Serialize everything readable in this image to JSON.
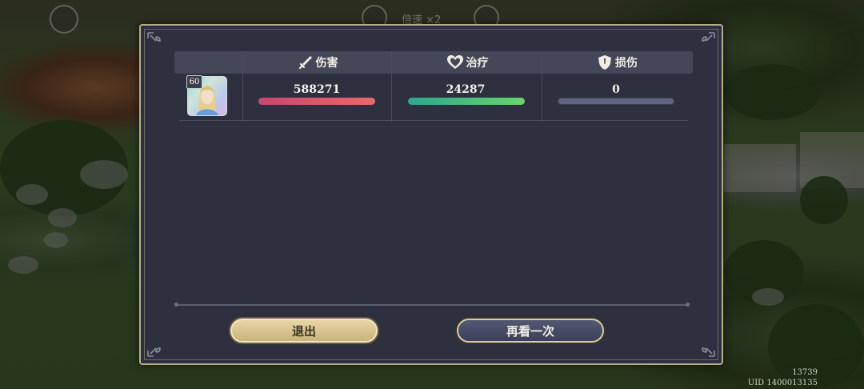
{
  "hud": {
    "speed_label": "倍速 ×2",
    "player_id": "13739",
    "uid": "UID 1400013135"
  },
  "panel": {
    "columns": [
      {
        "label": "伤害",
        "icon": "sword-icon"
      },
      {
        "label": "治疗",
        "icon": "heart-icon"
      },
      {
        "label": "损伤",
        "icon": "shield-icon"
      }
    ],
    "rows": [
      {
        "level": "60",
        "damage": {
          "value": "588271",
          "fill": 1.0,
          "color_from": "#c5486f",
          "color_to": "#e86a6a"
        },
        "healing": {
          "value": "24287",
          "fill": 1.0,
          "color_from": "#2fa58e",
          "color_to": "#6cd26a"
        },
        "taken": {
          "value": "0",
          "fill": 0.0,
          "color_from": "#5d6580",
          "color_to": "#5d6580"
        }
      }
    ],
    "buttons": {
      "exit": "退出",
      "replay": "再看一次"
    }
  }
}
